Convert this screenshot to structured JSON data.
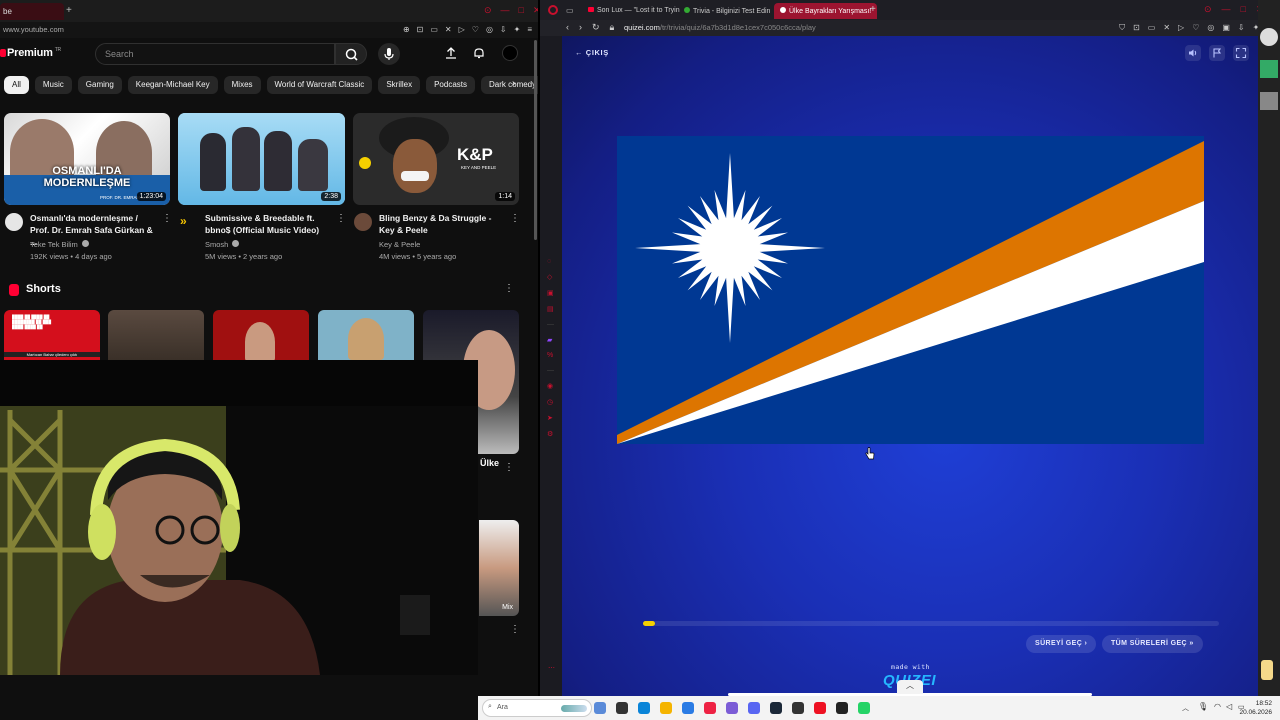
{
  "youtube": {
    "tab_fragment": "be",
    "url": "www.youtube.com",
    "logo": "Premium",
    "logo_region": "TR",
    "search_placeholder": "Search",
    "chips": [
      "All",
      "Music",
      "Gaming",
      "Keegan-Michael Key",
      "Mixes",
      "World of Warcraft Classic",
      "Skrillex",
      "Podcasts",
      "Dark comedy"
    ],
    "videos": [
      {
        "thumb_text": "OSMANLI'DA MODERNLEŞME",
        "thumb_sub": "PROF. DR. EMRAH SAFA",
        "duration": "1:23:04",
        "title": "Osmanlı'da modernleşme / Prof. Dr. Emrah Safa Gürkan & ...",
        "channel": "Teke Tek Bilim",
        "meta": "192K views • 4 days ago"
      },
      {
        "duration": "2:38",
        "title": "Submissive & Breedable ft. bbno$ (Official Music Video)",
        "channel": "Smosh",
        "meta": "5M views • 2 years ago"
      },
      {
        "thumb_text": "K&P",
        "thumb_sub": "KEY AND PEELE",
        "duration": "1:14",
        "title": "Bling Benzy & Da Struggle - Key & Peele",
        "channel": "Key & Peele",
        "meta": "4M views • 5 years ago"
      }
    ],
    "shorts_title": "Shorts",
    "short1_text": "Martıcan Bahar çiledenı çıktı",
    "partial_title": "Ülke",
    "mix_label": "Mix"
  },
  "quiz": {
    "tabs": [
      "Son Lux — \"Lost it to Tryin",
      "Trivia - Bilginizi Test Edin",
      "Ülke Bayrakları Yarışması!"
    ],
    "url_host": "quizei.com",
    "url_path": "/tr/trivia/quiz/6a7b3d1d8e1cex7c050c6cca/play",
    "exit_label": "ÇIKIŞ",
    "skip_label": "SÜREYİ GEÇ",
    "skip_all_label": "TÜM SÜRELERİ GEÇ",
    "made_with": "made with",
    "brand": "QUIZEI",
    "progress": 0.02
  },
  "taskbar": {
    "search_placeholder": "Ara",
    "time": "18:52",
    "date": "20.06.2026"
  },
  "colors": {
    "flag_blue": "#003893",
    "flag_orange": "#dd7500",
    "flag_white": "#ffffff",
    "progress_yellow": "#f5d000",
    "opera_red": "#c8102e"
  }
}
